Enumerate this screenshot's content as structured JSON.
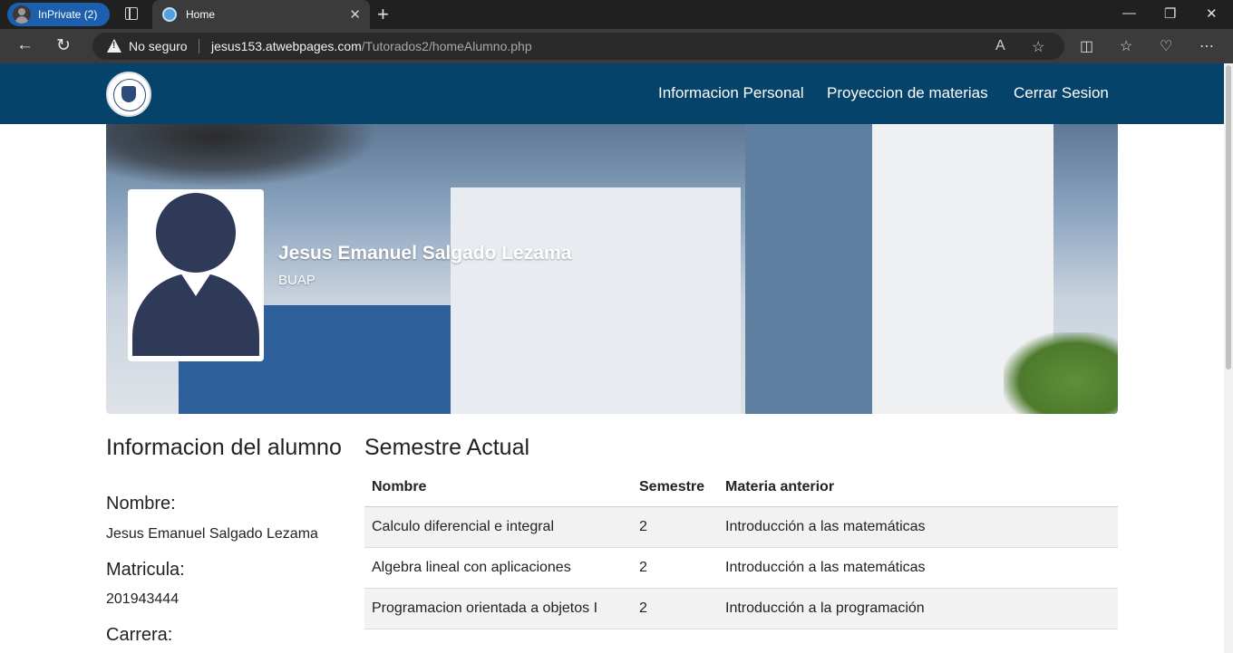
{
  "browser": {
    "profile_label": "InPrivate (2)",
    "tab_title": "Home",
    "security_label": "No seguro",
    "url_domain": "jesus153.atwebpages.com",
    "url_path": "/Tutorados2/homeAlumno.php"
  },
  "nav": {
    "links": [
      "Informacion Personal",
      "Proyeccion de materias",
      "Cerrar Sesion"
    ]
  },
  "hero": {
    "name": "Jesus Emanuel Salgado Lezama",
    "org": "BUAP"
  },
  "info": {
    "title": "Informacion del alumno",
    "nombre_label": "Nombre:",
    "nombre_value": "Jesus Emanuel Salgado Lezama",
    "matricula_label": "Matricula:",
    "matricula_value": "201943444",
    "carrera_label": "Carrera:"
  },
  "semestre": {
    "title": "Semestre Actual",
    "headers": [
      "Nombre",
      "Semestre",
      "Materia anterior"
    ],
    "rows": [
      [
        "Calculo diferencial e integral",
        "2",
        "Introducción a las matemáticas"
      ],
      [
        "Algebra lineal con aplicaciones",
        "2",
        "Introducción a las matemáticas"
      ],
      [
        "Programacion orientada a objetos I",
        "2",
        "Introducción a la programación"
      ]
    ]
  },
  "colors": {
    "nav_bg": "#06436a",
    "avatar": "#2f3958",
    "browser_accent": "#1b5fae"
  }
}
